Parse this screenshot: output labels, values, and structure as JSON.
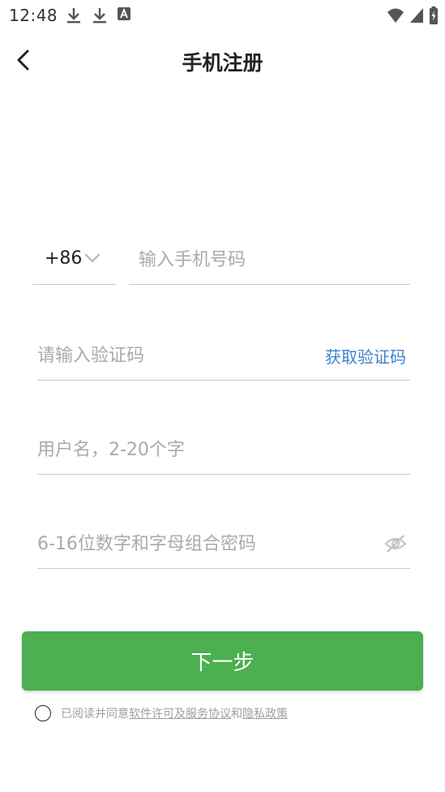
{
  "status_bar": {
    "time": "12:48",
    "icons_left": [
      "download-icon",
      "download-icon",
      "app-notification-icon"
    ],
    "icons_right": [
      "wifi-icon",
      "cellular-signal-icon",
      "battery-charging-icon"
    ]
  },
  "header": {
    "title": "手机注册",
    "back_icon": "back-arrow-icon"
  },
  "form": {
    "country_code": "+86",
    "phone_placeholder": "输入手机号码",
    "code_placeholder": "请输入验证码",
    "get_code_label": "获取验证码",
    "username_placeholder": "用户名，2-20个字",
    "password_placeholder": "6-16位数字和字母组合密码",
    "password_visibility_icon": "eye-off-icon"
  },
  "actions": {
    "next_label": "下一步"
  },
  "agreement": {
    "prefix": "已阅读并同意 ",
    "license_link": "软件许可及服务协议",
    "and": "和",
    "privacy_link": "隐私政策"
  },
  "colors": {
    "primary_green": "#4caf50",
    "link_blue": "#3f82cf",
    "divider": "#c8c8c8",
    "placeholder": "#aaaaaa"
  }
}
